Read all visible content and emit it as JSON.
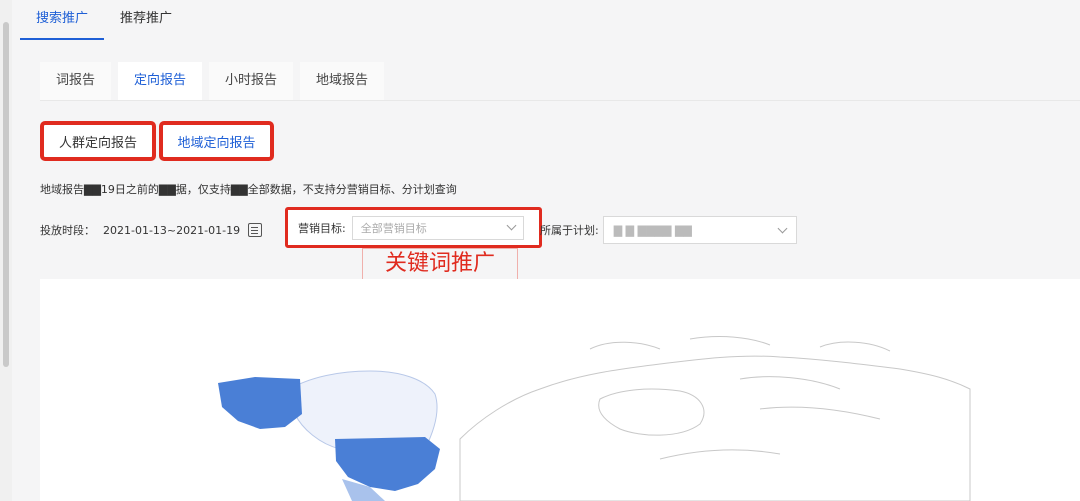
{
  "top_tabs": [
    {
      "label": "搜索推广",
      "active": true
    },
    {
      "label": "推荐推广",
      "active": false
    }
  ],
  "report_tabs": [
    {
      "label": "词报告",
      "active": false
    },
    {
      "label": "定向报告",
      "active": true
    },
    {
      "label": "小时报告",
      "active": false
    },
    {
      "label": "地域报告",
      "active": false
    }
  ],
  "sub_tabs": {
    "crowd": "人群定向报告",
    "region": "地域定向报告"
  },
  "notice": "地域报告▇▇19日之前的▇▇据，仅支持▇▇全部数据，不支持分营销目标、分计划查询",
  "filters": {
    "date_label": "投放时段：",
    "date_value": "2021-01-13~2021-01-19",
    "goal_label": "营销目标:",
    "goal_placeholder": "全部营销目标",
    "plan_label": "所属于计划:",
    "plan_value": "▇ ▇ ▇▇▇▇ ▇▇"
  },
  "annotation": "关键词推广",
  "map": {
    "highlight_dark": "#4a7fd6",
    "highlight_light": "#eef2fb",
    "highlight_mid": "#a9c2ec"
  }
}
